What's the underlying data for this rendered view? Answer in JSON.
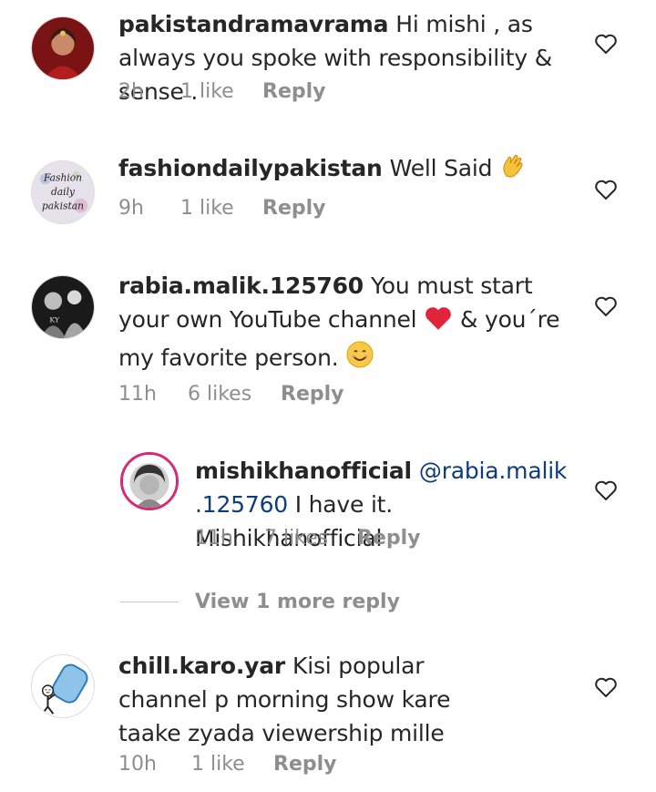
{
  "comments": [
    {
      "username": "pakistandramavrama",
      "text": "Hi mishi , as always you spoke with responsibility & sense .",
      "time": "2h",
      "likes": "1 like",
      "reply": "Reply"
    },
    {
      "username": "fashiondailypakistan",
      "text": "Well Said",
      "emoji": "clapping-hands-icon",
      "time": "9h",
      "likes": "1 like",
      "reply": "Reply",
      "avatar_text": [
        "Fashion",
        "daily",
        "pakistan"
      ]
    },
    {
      "username": "rabia.malik.125760",
      "text_1": "You must start your own YouTube channel",
      "text_2": "& you´re my favorite person.",
      "time": "11h",
      "likes": "6 likes",
      "reply": "Reply"
    },
    {
      "username": "chill.karo.yar",
      "text": "Kisi popular channel p morning show kare taake zyada viewership mille",
      "time": "10h",
      "likes": "1 like",
      "reply": "Reply"
    }
  ],
  "reply_comment": {
    "username": "mishikhanofficial",
    "mention": "@rabia.malik .125760",
    "text": "I have it. Mishikhanofficial",
    "time": "11h",
    "likes": "7 likes",
    "reply": "Reply"
  },
  "view_more": "View 1 more reply",
  "colors": {
    "text": "#262626",
    "meta": "#8e8e8e",
    "mention": "#0d3d7a",
    "heart_red": "#e0243b",
    "story_ring": "#d62976"
  }
}
